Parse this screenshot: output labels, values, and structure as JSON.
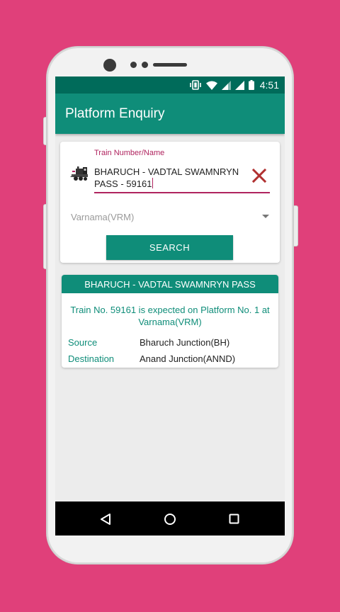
{
  "status_bar": {
    "time": "4:51",
    "icons": [
      "vibrate-icon",
      "wifi-icon",
      "signal-icon",
      "signal-icon",
      "battery-icon"
    ]
  },
  "app_bar": {
    "title": "Platform Enquiry"
  },
  "search_form": {
    "train_label": "Train Number/Name",
    "train_line1": "BHARUCH - VADTAL SWAMNRYN",
    "train_line2": "PASS - 59161",
    "station_value": "Varnama(VRM)",
    "search_label": "SEARCH"
  },
  "result": {
    "train_name": "BHARUCH - VADTAL SWAMNRYN PASS",
    "message": "Train No. 59161 is expected on Platform No. 1 at Varnama(VRM)",
    "source_label": "Source",
    "source_value": "Bharuch Junction(BH)",
    "destination_label": "Destination",
    "destination_value": "Anand Junction(ANND)"
  },
  "colors": {
    "primary": "#0f8d79",
    "primary_dark": "#006b5a",
    "accent": "#b0245f",
    "clear_icon": "#b03030",
    "background": "#e0407a"
  }
}
